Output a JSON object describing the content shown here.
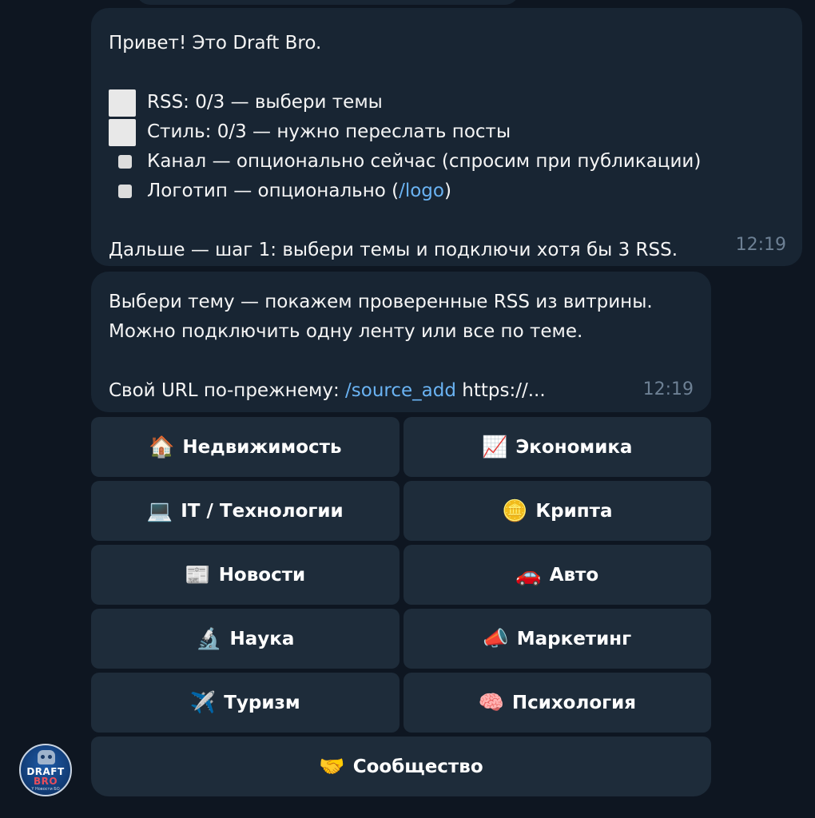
{
  "messages": [
    {
      "greeting": "Привет! Это Draft Bro.",
      "checklist": [
        {
          "text": "RSS: 0/3 — выбери темы"
        },
        {
          "text": "Стиль: 0/3 — нужно переслать посты"
        },
        {
          "text": "Канал — опционально сейчас (спросим при публикации)"
        },
        {
          "text_before": "Логотип — опционально (",
          "link": "/logo",
          "text_after": ")"
        }
      ],
      "next_step": "Дальше — шаг 1: выбери темы и подключи хотя бы 3 RSS.",
      "time": "12:19"
    },
    {
      "line1": "Выбери тему — покажем проверенные RSS из витрины.",
      "line2": "Можно подключить одну ленту или все по теме.",
      "url_prefix": "Свой URL по-прежнему: ",
      "url_command": "/source_add",
      "url_suffix": " https://...",
      "time": "12:19"
    }
  ],
  "keyboard": [
    {
      "icon": "🏠",
      "label": "Недвижимость"
    },
    {
      "icon": "📈",
      "label": "Экономика"
    },
    {
      "icon": "💻",
      "label": "IT / Технологии"
    },
    {
      "icon": "🪙",
      "label": "Крипта"
    },
    {
      "icon": "📰",
      "label": "Новости"
    },
    {
      "icon": "🚗",
      "label": "Авто"
    },
    {
      "icon": "🔬",
      "label": "Наука"
    },
    {
      "icon": "📣",
      "label": "Маркетинг"
    },
    {
      "icon": "✈️",
      "label": "Туризм"
    },
    {
      "icon": "🧠",
      "label": "Психология"
    },
    {
      "icon": "🤝",
      "label": "Сообщество"
    }
  ],
  "avatar": {
    "line1": "DRAFT",
    "line2": "BRO",
    "tagline": "Y Новости БО"
  },
  "colors": {
    "background": "#0e1621",
    "bubble": "#182533",
    "button": "#1e2c3a",
    "link": "#6ab3f3",
    "timestamp": "#6d8094"
  }
}
